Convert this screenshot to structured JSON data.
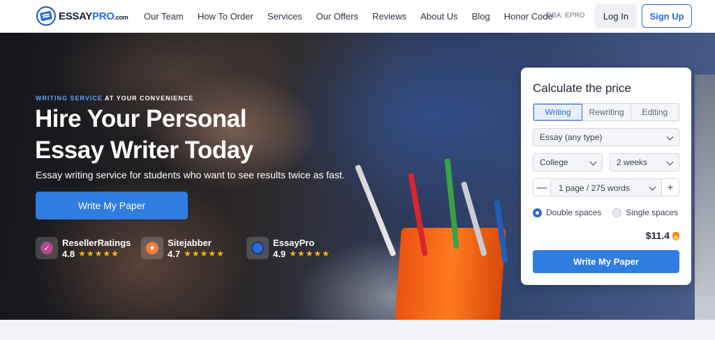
{
  "header": {
    "logo": {
      "brand": "ESSAY",
      "brand_accent": "PRO",
      "suffix": ".com"
    },
    "nav": [
      "Our Team",
      "How To Order",
      "Services",
      "Our Offers",
      "Reviews",
      "About Us",
      "Blog",
      "Honor Code"
    ],
    "dba": "DBA: EPRO",
    "login_label": "Log In",
    "signup_label": "Sign Up"
  },
  "hero": {
    "eyebrow_accent": "WRITING SERVICE",
    "eyebrow_rest": " AT YOUR CONVENIENCE",
    "title_line1": "Hire Your Personal",
    "title_line2": "Essay Writer Today",
    "subtitle": "Essay writing service for students who want to see results twice as fast.",
    "cta_label": "Write My Paper",
    "ratings": [
      {
        "name": "ResellerRatings",
        "score": "4.8",
        "icon": "resellerratings-icon"
      },
      {
        "name": "Sitejabber",
        "score": "4.7",
        "icon": "sitejabber-icon"
      },
      {
        "name": "EssayPro",
        "score": "4.9",
        "icon": "essaypro-icon"
      }
    ],
    "stars": "★★★★★"
  },
  "calculator": {
    "title": "Calculate the price",
    "tabs": [
      "Writing",
      "Rewriting",
      "Editing"
    ],
    "active_tab": "Writing",
    "paper_type": "Essay (any type)",
    "level": "College",
    "deadline": "2 weeks",
    "pages": "1 page / 275 words",
    "minus": "—",
    "plus": "+",
    "spacing_options": [
      "Double spaces",
      "Single spaces"
    ],
    "selected_spacing": "Double spaces",
    "price": "$11.4",
    "cta_label": "Write My Paper"
  },
  "colors": {
    "accent": "#2f7de1",
    "brand": "#2a6bd8",
    "star": "#f5b914"
  }
}
